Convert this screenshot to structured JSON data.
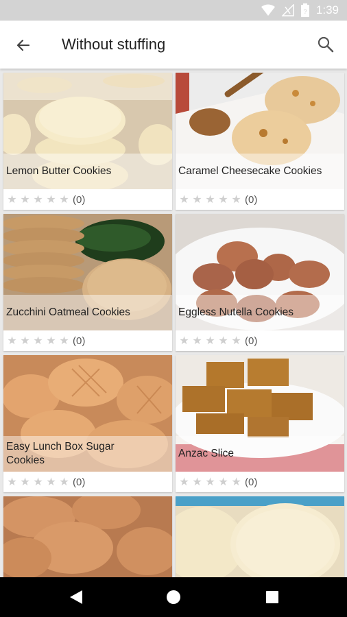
{
  "status_bar": {
    "time": "1:39",
    "icons": [
      "wifi-icon",
      "signal-icon",
      "battery-icon"
    ]
  },
  "app_bar": {
    "title": "Without stuffing",
    "back_icon": "arrow-back-icon",
    "search_icon": "search-icon"
  },
  "recipes": [
    {
      "name": "Lemon Butter Cookies",
      "rating_count": "(0)",
      "stars": 0
    },
    {
      "name": "Caramel Cheesecake Cookies",
      "rating_count": "(0)",
      "stars": 0
    },
    {
      "name": "Zucchini Oatmeal Cookies",
      "rating_count": "(0)",
      "stars": 0
    },
    {
      "name": "Eggless Nutella Cookies",
      "rating_count": "(0)",
      "stars": 0
    },
    {
      "name": "Easy Lunch Box Sugar Cookies",
      "rating_count": "(0)",
      "stars": 0
    },
    {
      "name": "Anzac Slice",
      "rating_count": "(0)",
      "stars": 0
    }
  ],
  "nav_bar": {
    "buttons": [
      "back-triangle-icon",
      "home-circle-icon",
      "recents-square-icon"
    ]
  }
}
